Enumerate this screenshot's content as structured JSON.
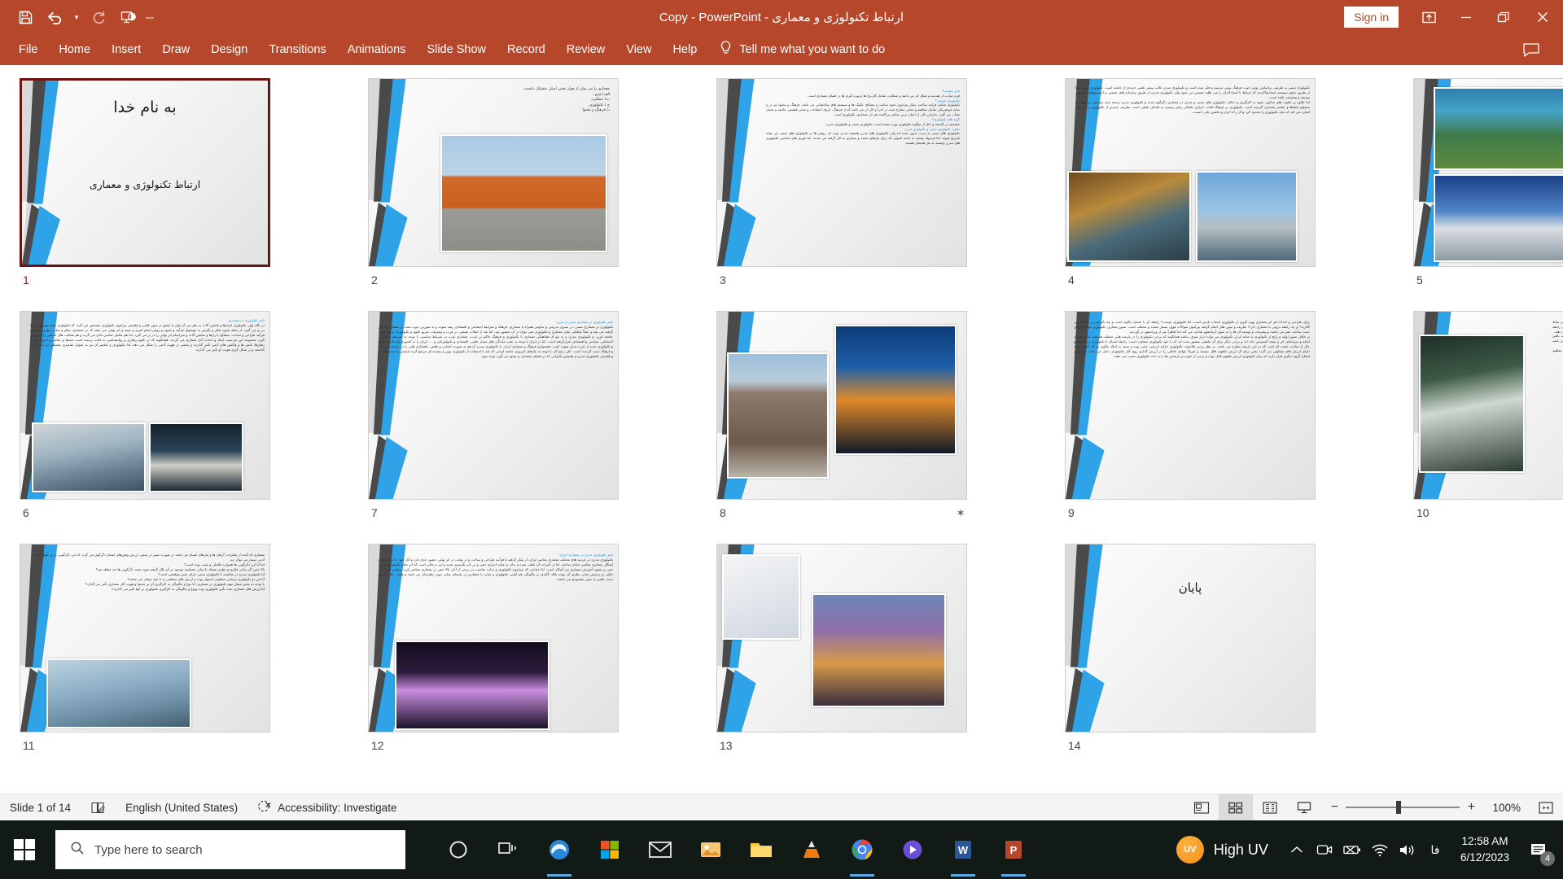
{
  "window": {
    "title": "ارتباط تکنولوژی و معماری  -  Copy  -  PowerPoint",
    "sign_in": "Sign in",
    "accent_color": "#b7472a"
  },
  "quick_access": [
    {
      "name": "save-icon",
      "label": "Save"
    },
    {
      "name": "undo-icon",
      "label": "Undo"
    },
    {
      "name": "undo-dropdown-icon",
      "label": "Undo options"
    },
    {
      "name": "redo-icon",
      "label": "Redo"
    },
    {
      "name": "start-presentation-icon",
      "label": "Start From Beginning"
    },
    {
      "name": "customize-quick-access-icon",
      "label": "Customize Quick Access Toolbar"
    }
  ],
  "ribbon": {
    "tabs": [
      {
        "label": "File"
      },
      {
        "label": "Home"
      },
      {
        "label": "Insert"
      },
      {
        "label": "Draw"
      },
      {
        "label": "Design"
      },
      {
        "label": "Transitions"
      },
      {
        "label": "Animations"
      },
      {
        "label": "Slide Show"
      },
      {
        "label": "Record"
      },
      {
        "label": "Review"
      },
      {
        "label": "View"
      },
      {
        "label": "Help"
      }
    ],
    "tell_me": "Tell me what you want to do"
  },
  "window_controls": {
    "ribbon_display": "Ribbon Display Options",
    "minimize": "Minimize",
    "restore": "Restore Down",
    "close": "Close"
  },
  "slides": [
    {
      "number": "1",
      "selected": true,
      "has_animation": false,
      "title": "به نام خدا",
      "subtitle": "ارتباط تکنولوژی و معماری",
      "layout": "title"
    },
    {
      "number": "2",
      "selected": false,
      "has_animation": false,
      "layout": "text-image",
      "body": "معماری را می توان از چهار بخش اصلی متشکل دانست\nالف) فرم ،\nب) عملکرد،\nج ) تکنولوژی،\nد) فرهنگ و محتوا",
      "image_caption": "gantry-crane-photo"
    },
    {
      "number": "3",
      "selected": false,
      "has_animation": false,
      "layout": "text-only",
      "sections": [
        {
          "head": "فرم چیست؟",
          "body": "فرم عبارت از هندسه و شکل اثر می باشد و عملکرد، شامل کاربری ها و بهره گیری ها در فضای معماری است."
        },
        {
          "head": "تکنولوژی چیست؟",
          "body": "تکنولوژی شامل فرایند ساخت، تفکر پیرامون نحوه ساخت و مصالح، تکنیک ها و سیستم های ساختمانی می باشد. فرهنگ و محتوا نیز در و نمایه غیرفیزیکی شامل مفاهیم و معانی مطرح شده در اجرا و کار اثر می باشد که از فرهنگ، تاریخ، اعتقادات و مبانی فلسفی جامعه و معمار نشأت می گیرد. بنابراین یکی از اصلی ترین عناصر برپاکننده هر اثر معماری، تکنولوژی است."
        },
        {
          "head": "گونه های تکنولوژی؟",
          "body": "معماری در گذشته و حال از دوگونه تکنولوژی بهره جسته است. تکنولوژی سنتی و تکنولوژی مدرن."
        },
        {
          "head": "تفاوت تکنولوژی سنتی و تکنولوژی مدرن:",
          "body": "تکنولوژی های سنتی به ندرت تدوین شده اند ولی تکنولوژی های مدرن همیشه مدرن بوده اند. روش ها در تکنولوژی های سنتی می تواند تشریح شوند، اما فرموله نیستند به مانند اصولی که برای نیازهای متعدد و بسیاری به کار گرفته می شدند. اما تئوری های اساسی تکنولوژی های مدرن وابسته به نیاز هایشان هستند"
        }
      ]
    },
    {
      "number": "4",
      "selected": false,
      "has_animation": false,
      "layout": "text-two-images",
      "body": "تکنولوژی سنتی به طریقی براساس روش خوب فرهنگ بومی ترسیم و فکر شده است و تکنولوژی مدرن غالب بینش علمی جدیدی از جامعه است. تکنولوژی سنتی تنها از طریق تداوم سیستم استادشاگردی که ارتباط با استادکاران را می طلبد تضمین می شود ولی تکنولوژی مدرن از طریق سازمان های صنعتی و انستیتوهای آموزشی توسعه و پیشرفت یافته است.\nاما علاوه بر تفاوت های مذکور، نحوه به کارگیری و دخالت تکنولوژی های سنتی و مدرن در معماری دگرگون شده و تکنولوژی مدرن رسمه ساز تغییراتی در هویت و محتوای فضاها و عناصر معماری گردیده است. تکنولوژی در فرهنگ لغات، ابزاری تکنیکی برای رسیدن به اهداف عملی است. تعاریف جدیدتر از تکنولوژی به این امر اشاره می کند که نباید تکنولوژی را محدود کرد و آن را با ابزار و ماشین یکی دانست."
    },
    {
      "number": "5",
      "selected": false,
      "has_animation": false,
      "layout": "two-images-only",
      "image_caption_top": "persian-tiled-ceiling-photo",
      "image_caption_bottom": "heydar-aliyev-center-photo"
    },
    {
      "number": "6",
      "selected": false,
      "has_animation": false,
      "layout": "heading-text-two-images",
      "heading": "تاثیر تکنولوژی در معماری:",
      "body": "در نگاه اول، تکنولوژی ابزارها و ماشین آلات به نظر می آید ولی با تعمق در صور علمی و فلسفی پیرامون تکنولوژی مشخص می گردد که تکنولوژی دامنه وسیع تری را در بر می گیرد. از جمله شیوه تفکر و نگرش به موضوع، فرآیند و شیوه و روش انجام امری و نتیجه و اثر نهایی می باشد که در معماری، تفکر و مبانی نظری، شیوه و فرآیند طراحی و ساخت، مصالح، ابزارها و ماشین آلات و سرانجام اثر نهایی را در بر می گیرد. لذا هم شامل عناصر مادی می گردد و هم فعالیت های انسانی را در برمی گیرد. مجموعه این دو سبب ایجاد و احداث آثار معماری می گردند. همانگونه که در علوم رفتاری و روانشناسی به اثبات رسیده است محیط و عناصر و اجرای آن بر رفتارها، کنش ها و واکنش های آدمی تأثیر گذارده و بخشی از هویت آدمی را شکل می دهد. لذا تکنولوژی و عناصر آن نیز به عنوان عناصری محیطی بر آدمی تأثیر گذاشته و بر شکل گیری هویت او تأثیر می گذارند."
    },
    {
      "number": "7",
      "selected": false,
      "has_animation": false,
      "layout": "heading-text",
      "heading": "تاثیر تکنولوژی در معماری سنتی و مدرن:",
      "body": "تکنولوژی در معماری سنتی، در سیری تدریجی و تداومی همراه با معماری، فرهنگ و شرایط اجتماعی و اقتصادی رشد نموده و به صورتی خوب شده در معماری به کار گرفته می شد و عملاً تفکیکی میان معماری و تکنولوژی نمی توان در آن متصور بود.\nاما بعد از انقلاب صنعتی در غرب و پیشرفت سریع علوم و تکنولوژی، و سازگاری جامعه غربی و تکنولوژی مدرن و به تبع آن هماهنگی معماری با تکنولوژی و فرهنگ حاکم بر غرب، معماری غرب در شرایط مناسبی با توجه به شرایط فرهنگی، اجتماعی، سیاسی و اقتصادی، قرارگرفته است. اما در ایران با توجه به عقب ماندگی های بسیار علمی، اقتصادی و تکنولوژیکی و .... ایران را به کشوری واردکننده علوم و تکنولوژی جدید از غرب تبدیل نموده است. همجواری فرهنگ و معماری ایرانی با تکنولوژی مدرن آن هم به صورت ابتدایی و ناقص، ناهنجاری هایی را در عرصه معماری و فرهنگ سبب گردیده است. علی رغم آن، با توجه به نیازهای امروزی جامعه ایرانی که باید با استفاده از تکنولوژی نوین و پیچیده ای مرتفع گردد بایستی به بستر فکری و فلسفی تکنولوژی مدرن و همچنین تأثیراتی که در فضای معماری به وجود می آورد توجه نمود"
    },
    {
      "number": "8",
      "selected": false,
      "has_animation": true,
      "layout": "two-images-only",
      "image_caption_left": "traditional-iranian-mosque-photo",
      "image_caption_right": "tehran-night-cityscape-photo"
    },
    {
      "number": "9",
      "selected": false,
      "has_animation": false,
      "layout": "text-only",
      "body": "برای طراحی و احداث هر اثر معماری بهره گیری از تکنولوژی اجتناب ناپذیر است، اما تکنولوژی چیست؟ رابطه آن با انسان چگونه است و چه تأثیراتی بر یکدیگر می گذارند؟ و چه رابطه درونی با معماری دارد؟ تعاریف و تبیین های انجام گرفته پیرامون سوالات فوق، بسیار متعدد و مختلف است. تصور متعارف تکنولوژی تنها ابزارهای دست ساخت بشر می باشند و پیشرفت و توسعه آن ها را به سوی آرمانشهر هدایت می کند اما ظاهراً سر از ویرانشهر در آوردیم.\nبر خلاف تصور اولیه و رایج از تکنولوژی به مثابه ابزار، تکنولوژی می تواند ابزار صرف نباشد همانگونه که برخی تکنولوژی را در عرصه هایی مختلف همچون تفکر، فرآیند انجام و سرانجام، اثر و نتیجه گسترش داده اند و برخی دیگر برای آن ماهیتی متصور شده اند که با خود تکنولوژی متفاوت است. رابطه انسان با تکنولوژی در گذشته و حال از مباحث عمده ای است که در این عرصه مطرح می باشد. در نظر برخی فلاسفه، تکنولوژی دارای ارزشی خنثی بوده و بسته به اینکه چگونه به کار گرفته شود دارای ارزش های متفاوتی می گردد یعنی برای آن ارزش ماهوی قائل نیستند و صرفاً عوامل فاعلی را در ارزش گذاری روی آثار تکنولوژی دخیل می دانند. در مقابل ایشان گروه دیگری قرار دارند که برای تکنولوژی ارزش ماهوی قائل بوده و برخی از عیوب و نارسایی ها را به ذات تکنولوژی نسبت می دهند."
    },
    {
      "number": "10",
      "selected": false,
      "has_animation": false,
      "layout": "text-image-right",
      "body": "مثل شمسی، همکار و زاگ اثر در دسته فلاسفه هستند که هر یک برخی نقاط مهم و بایک تکنولوژی دیده را بیان کرده و راه ساز طولی را برای رابطه وضعیت مناسب تکنولوژی و چگونگی رهایی از مشکلات آن پیشنهاد می دهند.\nمسیر تکنولوژی در عرصه های مختلف و شکل گیری ملک اولیه مانند بافتن هنر فرآیند طراحی و ساخت، و خود سازه از آن به اشکال مختلفی می باشد که بر شکل گیری فضای معماری و عناصر آن بسیار مؤثر است.\nپیشنهاد ایران هم اثر از کل و ارزیابی آن را در عمق خاص شناخت مفاهیم اصلی ساز و کار خدمات بازی و باز بهتر انجام می گیرد."
    },
    {
      "number": "11",
      "selected": false,
      "has_animation": false,
      "layout": "text-image",
      "body": "معماری که آمده از تفکرات، آرمان ها و نیازهای انسان می باشد در صورت تغییر در بینش، ارزش وباورهای انسان دگرگون می گردد که این دگرگونی را در طول حیات آدمی بسیار می توان دید.\nاما آیا این دگرگونی ها همواره تکاملی و مثبت بوده است؟\nبالا خص اگر مبانی فکری و نظری متضاد با مبانی معماری موجود در آن بکار گرفته شود نتیجه دگرگونی ها چه خواهد بود؟\nآیا تکنولوژی مدرن در مقایسه با تکنولوژی سنتی دارای چنین موقعیتی است؟\nآیا این دو تکنولوژی برمبانی متفاوتی استوار بوده و ارزش های مختلفی را با خود منتقل می نمایند؟\nبا توجه به نقش بسیار مهم تکنولوژی در معماری، آیا نوع و چگونگی به کارگیری آن بر محتوا و هویت آثار معماری تأثیر می گذارد؟\nآیا ارزش های معماری تحت تأثیر تکنولوژی بوده ونوع و چگونگی به کارگیری تکنولوژی بر آنها تأثیر می گذارند؟"
    },
    {
      "number": "12",
      "selected": false,
      "has_animation": false,
      "layout": "heading-text-image",
      "heading": "تاثیر تکنولوژی مدرن در معماری ایران:",
      "body": "تکنولوژی مدرن در عرصه های مختلف معماری معاصر ایران، از تفکر گرفته تا فرآیند طراحی و ساخت و در نهایت در اثر نهایی حضور جدی دارد و آثار خود را در فضاها و اشکال معماری معاصر نمایان ساخته، اما از تأثیرات آن غفلت شده و بدان به مثابه ابزاری خنثی و بی اثر نگریسته شده و این درحالی است که اثر تفکر تکنولوژی مدرن حتی بر شیوه آموزش معماری نیز آشکار است. لذا مباحثی که پیرامون تکنولوژی و سازه مناسب در برخی از آثار، بالا خص در معماری معاصر غرب مطرح می گردد دلیلی بر پذیرش مبانی نظری آن نبوده بلکه تأکیدی بر چگونگی هم آوایی تکنولوژی و سازه با معماری در راستای مبانی مورد نظرشان می باشد و هدف، باقی شیوه دست یافتن به چنین مقصودی می باشند."
    },
    {
      "number": "13",
      "selected": false,
      "has_animation": false,
      "layout": "two-images-only",
      "image_caption_left": "architectural-sketch-diagram",
      "image_caption_right": "modern-facade-building-render"
    },
    {
      "number": "14",
      "selected": false,
      "has_animation": false,
      "layout": "end",
      "title": "پایان"
    }
  ],
  "status_bar": {
    "slide_indicator": "Slide 1 of 14",
    "notes_icon": "notes-icon",
    "language": "English (United States)",
    "accessibility": "Accessibility: Investigate",
    "views": [
      {
        "name": "normal-view",
        "label": "Normal",
        "active": false
      },
      {
        "name": "slide-sorter-view",
        "label": "Slide Sorter",
        "active": true
      },
      {
        "name": "reading-view",
        "label": "Reading View",
        "active": false
      },
      {
        "name": "slide-show-view",
        "label": "Slide Show",
        "active": false
      }
    ],
    "zoom_out": "−",
    "zoom_in": "+",
    "zoom_level": "100%",
    "fit_to_window": "Fit slide to current window"
  },
  "taskbar": {
    "search_placeholder": "Type here to search",
    "apps": [
      {
        "name": "cortana-icon",
        "label": "Cortana"
      },
      {
        "name": "task-view-icon",
        "label": "Task View"
      },
      {
        "name": "edge-icon",
        "label": "Microsoft Edge"
      },
      {
        "name": "store-icon",
        "label": "Microsoft Store"
      },
      {
        "name": "mail-icon",
        "label": "Mail"
      },
      {
        "name": "photos-icon",
        "label": "Photos"
      },
      {
        "name": "file-explorer-icon",
        "label": "File Explorer"
      },
      {
        "name": "vlc-icon",
        "label": "VLC media player"
      },
      {
        "name": "chrome-icon",
        "label": "Google Chrome"
      },
      {
        "name": "media-icon",
        "label": "Media Player"
      },
      {
        "name": "word-icon",
        "label": "Microsoft Word"
      },
      {
        "name": "powerpoint-icon",
        "label": "Microsoft PowerPoint"
      }
    ],
    "uv_badge": "UV",
    "uv_label": "High UV",
    "tray": [
      {
        "name": "show-hidden-icons-chevron"
      },
      {
        "name": "camera-icon"
      },
      {
        "name": "battery-icon"
      },
      {
        "name": "wifi-icon"
      },
      {
        "name": "volume-icon"
      },
      {
        "name": "language-indicator",
        "label": "فا"
      }
    ],
    "time": "12:58 AM",
    "date": "6/12/2023",
    "notification_count": "4"
  }
}
